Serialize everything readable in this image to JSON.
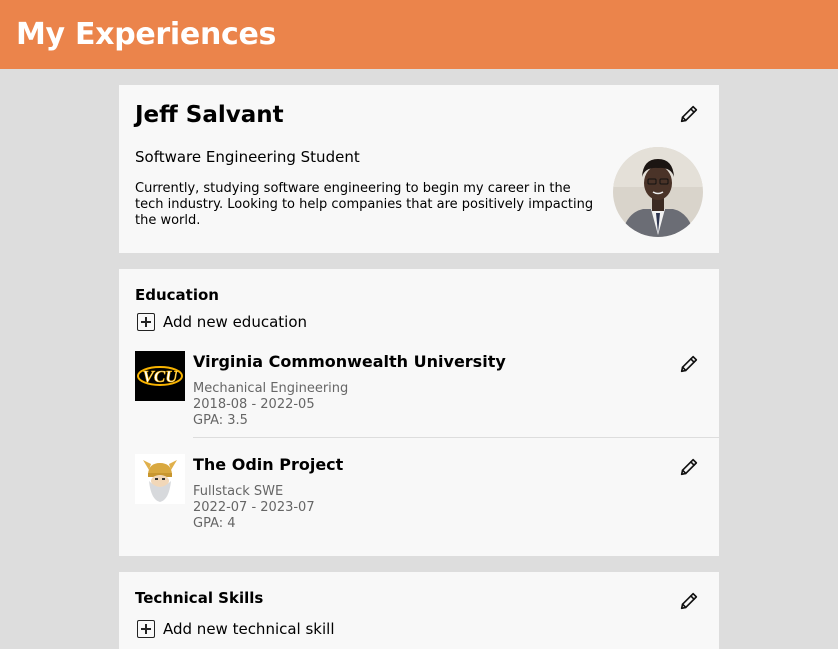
{
  "header": {
    "title": "My Experiences"
  },
  "profile": {
    "name": "Jeff Salvant",
    "role": "Software Engineering Student",
    "bio": "Currently, studying software engineering to begin my career in the tech industry. Looking to help companies that are positively impacting the world."
  },
  "education": {
    "title": "Education",
    "add_label": "Add new education",
    "items": [
      {
        "school": "Virginia Commonwealth University",
        "field": "Mechanical Engineering",
        "dates": "2018-08 - 2022-05",
        "gpa": "GPA: 3.5",
        "logo_text": "VCU"
      },
      {
        "school": "The Odin Project",
        "field": "Fullstack SWE",
        "dates": "2022-07 - 2023-07",
        "gpa": "GPA: 4"
      }
    ]
  },
  "skills": {
    "title": "Technical Skills",
    "add_label": "Add new technical skill"
  },
  "colors": {
    "header_bg": "#eb844b",
    "page_bg": "#dddddd",
    "card_bg": "#f8f8f8",
    "vcu_gold": "#f8b300"
  },
  "icons": {
    "edit": "pencil-icon",
    "add": "plus-square-icon"
  }
}
